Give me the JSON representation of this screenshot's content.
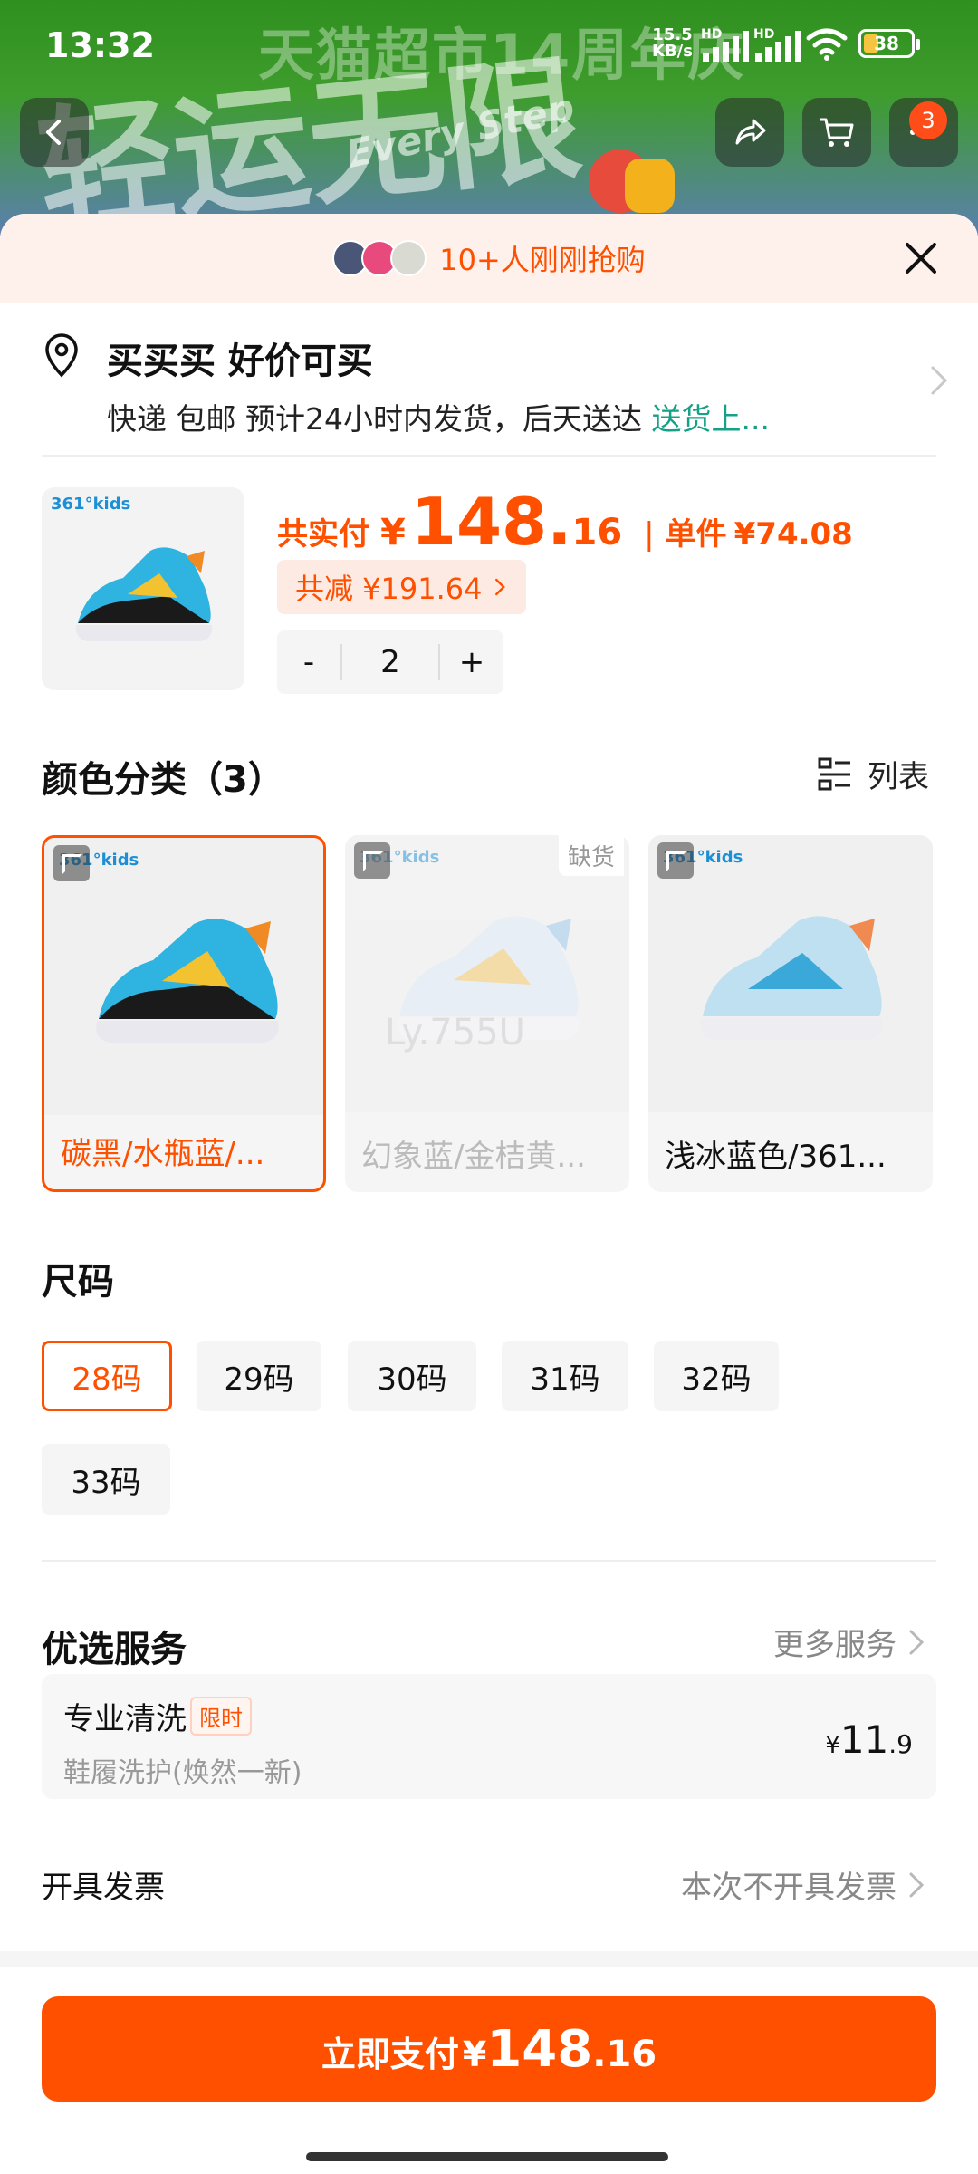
{
  "status_bar": {
    "time": "13:32",
    "net_speed": "15.5",
    "net_unit": "KB/s",
    "hd1": "HD",
    "hd2": "HD",
    "battery": "38"
  },
  "backdrop": {
    "banner_text": "天猫超市14周年庆",
    "deco_text": "轻运无限",
    "deco_en": "Every Step",
    "cart_badge": "3"
  },
  "sheet": {
    "buyers_text": "10+人刚刚抢购"
  },
  "address": {
    "name": "买买买 好价可买",
    "delivery": "快递 包邮 预计24小时内发货，后天送达 ",
    "delivery_link": "送货上..."
  },
  "product": {
    "brand": "361°kids",
    "total_label": "共实付",
    "currency": "¥",
    "total_int": "148.",
    "total_dec": "16",
    "unit_label": "单件",
    "unit_price": "¥74.08",
    "discount": "共减 ¥191.64",
    "quantity": "2",
    "minus": "-",
    "plus": "+"
  },
  "colors": {
    "title": "颜色分类（3）",
    "list_label": "列表",
    "out_of_stock": "缺货",
    "watermark": "Ly.755U",
    "items": [
      {
        "name": "碳黑/水瓶蓝/...",
        "selected": true
      },
      {
        "name": "幻象蓝/金桔黄...",
        "selected": false
      },
      {
        "name": "浅冰蓝色/361...",
        "selected": false
      }
    ]
  },
  "sizes": {
    "title": "尺码",
    "items": [
      "28码",
      "29码",
      "30码",
      "31码",
      "32码",
      "33码"
    ],
    "selected": "28码"
  },
  "services": {
    "title": "优选服务",
    "more": "更多服务",
    "item_name": "专业清洗",
    "item_tag": "限时",
    "item_desc": "鞋履洗护(焕然一新)",
    "price_currency": "¥",
    "price_int": "11",
    "price_dec": ".9"
  },
  "invoice": {
    "label": "开具发票",
    "value": "本次不开具发票"
  },
  "pay": {
    "label": "立即支付",
    "currency": "¥",
    "amount_int": "148",
    "amount_dec": ".16"
  },
  "colors_theme": {
    "accent": "#ff5000",
    "link": "#16a085"
  }
}
